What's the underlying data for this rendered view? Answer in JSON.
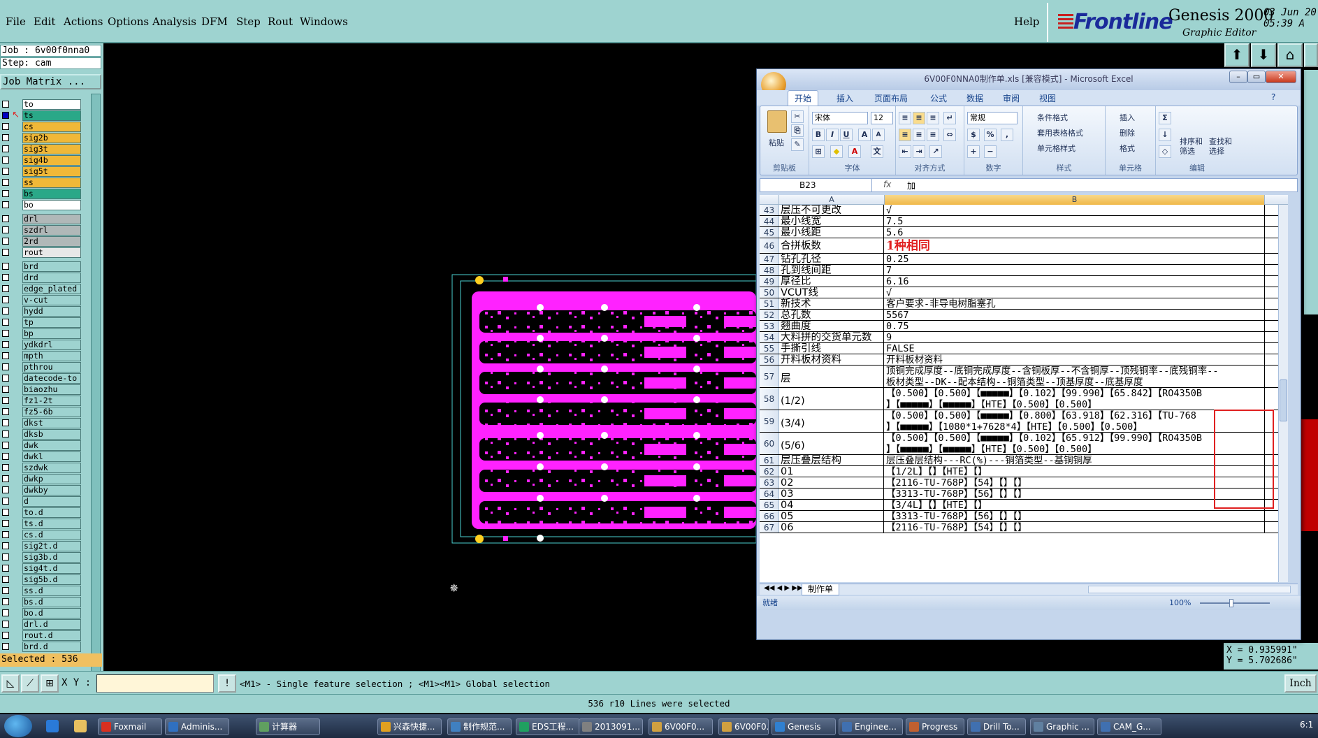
{
  "menu": [
    "File",
    "Edit",
    "Actions",
    "Options",
    "Analysis",
    "DFM",
    "Step",
    "Rout",
    "Windows"
  ],
  "help": "Help",
  "brand": {
    "name": "Frontline",
    "product": "Genesis 2000",
    "subtitle": "Graphic Editor",
    "date": "03 Jun 20",
    "time": "05:39 A"
  },
  "job": {
    "job_line": "Job : 6v00f0nna0",
    "step_line": "Step: cam",
    "matrix_label": "Job Matrix ..."
  },
  "layers": [
    {
      "name": "to",
      "color": "#ffffff"
    },
    {
      "name": "ts",
      "color": "#2aa888",
      "selected": true
    },
    {
      "name": "cs",
      "color": "#f0b838"
    },
    {
      "name": "sig2b",
      "color": "#f0b838"
    },
    {
      "name": "sig3t",
      "color": "#f0b838"
    },
    {
      "name": "sig4b",
      "color": "#f0b838"
    },
    {
      "name": "sig5t",
      "color": "#f0b838"
    },
    {
      "name": "ss",
      "color": "#f0b838"
    },
    {
      "name": "bs",
      "color": "#2aa888"
    },
    {
      "name": "bo",
      "color": "#ffffff"
    },
    {
      "name": "drl",
      "color": "#b0b8b8"
    },
    {
      "name": "szdrl",
      "color": "#b0b8b8"
    },
    {
      "name": "2rd",
      "color": "#b0b8b8"
    },
    {
      "name": "rout",
      "color": "#e8e8e8"
    },
    {
      "name": "brd",
      "color": "#9ed3d0"
    },
    {
      "name": "drd",
      "color": "#9ed3d0"
    },
    {
      "name": "edge_plated",
      "color": "#9ed3d0"
    },
    {
      "name": "v-cut",
      "color": "#9ed3d0"
    },
    {
      "name": "hydd",
      "color": "#9ed3d0"
    },
    {
      "name": "tp",
      "color": "#9ed3d0"
    },
    {
      "name": "bp",
      "color": "#9ed3d0"
    },
    {
      "name": "ydkdrl",
      "color": "#9ed3d0"
    },
    {
      "name": "mpth",
      "color": "#9ed3d0"
    },
    {
      "name": "pthrou",
      "color": "#9ed3d0"
    },
    {
      "name": "datecode-to",
      "color": "#9ed3d0"
    },
    {
      "name": "biaozhu",
      "color": "#9ed3d0"
    },
    {
      "name": "fz1-2t",
      "color": "#9ed3d0"
    },
    {
      "name": "fz5-6b",
      "color": "#9ed3d0"
    },
    {
      "name": "dkst",
      "color": "#9ed3d0"
    },
    {
      "name": "dksb",
      "color": "#9ed3d0"
    },
    {
      "name": "dwk",
      "color": "#9ed3d0"
    },
    {
      "name": "dwkl",
      "color": "#9ed3d0"
    },
    {
      "name": "szdwk",
      "color": "#9ed3d0"
    },
    {
      "name": "dwkp",
      "color": "#9ed3d0"
    },
    {
      "name": "dwkby",
      "color": "#9ed3d0"
    },
    {
      "name": "d",
      "color": "#9ed3d0"
    },
    {
      "name": "to.d",
      "color": "#9ed3d0"
    },
    {
      "name": "ts.d",
      "color": "#9ed3d0"
    },
    {
      "name": "cs.d",
      "color": "#9ed3d0"
    },
    {
      "name": "sig2t.d",
      "color": "#9ed3d0"
    },
    {
      "name": "sig3b.d",
      "color": "#9ed3d0"
    },
    {
      "name": "sig4t.d",
      "color": "#9ed3d0"
    },
    {
      "name": "sig5b.d",
      "color": "#9ed3d0"
    },
    {
      "name": "ss.d",
      "color": "#9ed3d0"
    },
    {
      "name": "bs.d",
      "color": "#9ed3d0"
    },
    {
      "name": "bo.d",
      "color": "#9ed3d0"
    },
    {
      "name": "drl.d",
      "color": "#9ed3d0"
    },
    {
      "name": "rout.d",
      "color": "#9ed3d0"
    },
    {
      "name": "brd.d",
      "color": "#9ed3d0"
    }
  ],
  "selected_count": "Selected : 536",
  "xy_label": "X Y :",
  "hint": "<M1> - Single feature selection ; <M1><M1> Global selection",
  "units": "Inch",
  "status": "536 r10 Lines were selected",
  "coords": {
    "x": "X = 0.935991\"",
    "y": "Y = 5.702686\""
  },
  "excel": {
    "title": "6V00F0NNA0制作单.xls [兼容模式] - Microsoft Excel",
    "tabs": [
      "开始",
      "插入",
      "页面布局",
      "公式",
      "数据",
      "审阅",
      "视图"
    ],
    "groups": {
      "clipboard": "剪贴板",
      "font": "字体",
      "align": "对齐方式",
      "number": "数字",
      "style": "样式",
      "cells": "单元格",
      "edit": "编辑"
    },
    "paste": "粘贴",
    "font_name": "宋体",
    "font_size": "12",
    "number_format": "常规",
    "cond_format": "条件格式",
    "table_format": "套用表格格式",
    "cell_style": "单元格样式",
    "insert": "插入",
    "delete": "删除",
    "format": "格式",
    "sort": "排序和筛选",
    "find": "查找和选择",
    "cell_ref": "B23",
    "fx": "fx",
    "formula": "加",
    "col_a": "A",
    "col_b": "B",
    "rows": [
      {
        "n": "43",
        "a": "层压不可更改",
        "b": "√"
      },
      {
        "n": "44",
        "a": "最小线宽",
        "b": "7.5"
      },
      {
        "n": "45",
        "a": "最小线距",
        "b": "5.6"
      },
      {
        "n": "46",
        "a": "合拼板数",
        "b": "1种相同",
        "big": true
      },
      {
        "n": "47",
        "a": "钻孔孔径",
        "b": "0.25"
      },
      {
        "n": "48",
        "a": "孔到线间距",
        "b": "7"
      },
      {
        "n": "49",
        "a": "厚径比",
        "b": "6.16"
      },
      {
        "n": "50",
        "a": "VCUT线",
        "b": "√"
      },
      {
        "n": "51",
        "a": "新技术",
        "b": "客户要求-非导电树脂塞孔"
      },
      {
        "n": "52",
        "a": "总孔数",
        "b": "5567"
      },
      {
        "n": "53",
        "a": "翘曲度",
        "b": "0.75"
      },
      {
        "n": "54",
        "a": "大料拼的交货单元数",
        "b": "9"
      },
      {
        "n": "55",
        "a": "手撕引线",
        "b": "FALSE"
      },
      {
        "n": "56",
        "a": "开料板材资料",
        "b": "开料板材资料"
      },
      {
        "n": "57",
        "a": "层",
        "b": "顶铜完成厚度--底铜完成厚度--含铜板厚--不含铜厚--顶残铜率--底残铜率--",
        "b2": "板材类型--DK--配本结构--铜箔类型--顶基厚度--底基厚度",
        "tall": true
      },
      {
        "n": "58",
        "a": "(1/2)",
        "b": "【0.500】【0.500】【■■■■■】【0.102】【99.990】【65.842】【RO4350B",
        "b2": "】【■■■■■】【■■■■■】【HTE】【0.500】【0.500】",
        "tall": true
      },
      {
        "n": "59",
        "a": "(3/4)",
        "b": "【0.500】【0.500】【■■■■■】【0.800】【63.918】【62.316】【TU-768",
        "b2": "】【■■■■■】【1080*1+7628*4】【HTE】【0.500】【0.500】",
        "tall": true
      },
      {
        "n": "60",
        "a": "(5/6)",
        "b": "【0.500】【0.500】【■■■■■】【0.102】【65.912】【99.990】【RO4350B",
        "b2": "】【■■■■■】【■■■■■】【HTE】【0.500】【0.500】",
        "tall": true
      },
      {
        "n": "61",
        "a": "层压叠层结构",
        "b": "层压叠层结构---RC(%)---铜箔类型--基铜铜厚"
      },
      {
        "n": "62",
        "a": "01",
        "b": "【1/2L】【】【HTE】【】"
      },
      {
        "n": "63",
        "a": "02",
        "b": "【2116-TU-768P】【54】【】【】"
      },
      {
        "n": "64",
        "a": "03",
        "b": "【3313-TU-768P】【56】【】【】"
      },
      {
        "n": "65",
        "a": "04",
        "b": "【3/4L】【】【HTE】【】"
      },
      {
        "n": "66",
        "a": "05",
        "b": "【3313-TU-768P】【56】【】【】"
      },
      {
        "n": "67",
        "a": "06",
        "b": "【2116-TU-768P】【54】【】【】"
      }
    ],
    "sheet": "制作单",
    "ready": "就绪",
    "zoom": "100%"
  },
  "taskbar": [
    "Foxmail",
    "Adminis...",
    "计算器",
    "兴森快捷...",
    "制作规范...",
    "EDS工程...",
    "2013091...",
    "6V00F0...",
    "6V00F0...",
    "Genesis",
    "Enginee...",
    "Progress",
    "Drill To...",
    "Graphic ...",
    "CAM_G..."
  ],
  "clock": "6:1"
}
